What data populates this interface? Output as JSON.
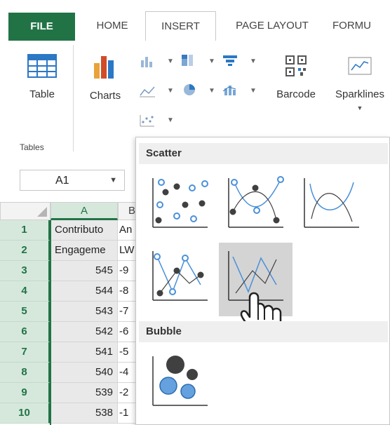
{
  "tabs": [
    {
      "label": "FILE"
    },
    {
      "label": "HOME"
    },
    {
      "label": "INSERT"
    },
    {
      "label": "PAGE LAYOUT"
    },
    {
      "label": "FORMU"
    }
  ],
  "ribbon": {
    "table_label": "Table",
    "charts_label": "Charts",
    "barcode_label": "Barcode",
    "sparklines_label": "Sparklines",
    "tables_group_label": "Tables"
  },
  "namebox": {
    "value": "A1"
  },
  "grid": {
    "columns": [
      "A",
      "B"
    ],
    "rows": [
      {
        "num": "1",
        "a": "Contributo",
        "b": "An"
      },
      {
        "num": "2",
        "a": "Engageme",
        "b": "LW"
      },
      {
        "num": "3",
        "a": "545",
        "b": "-9"
      },
      {
        "num": "4",
        "a": "544",
        "b": "-8"
      },
      {
        "num": "5",
        "a": "543",
        "b": "-7"
      },
      {
        "num": "6",
        "a": "542",
        "b": "-6"
      },
      {
        "num": "7",
        "a": "541",
        "b": "-5"
      },
      {
        "num": "8",
        "a": "540",
        "b": "-4"
      },
      {
        "num": "9",
        "a": "539",
        "b": "-2"
      },
      {
        "num": "10",
        "a": "538",
        "b": "-1"
      }
    ]
  },
  "popup": {
    "scatter_title": "Scatter",
    "bubble_title": "Bubble"
  },
  "colors": {
    "file_green": "#217346",
    "chart_blue": "#4a90d9",
    "chart_dark": "#404040"
  }
}
